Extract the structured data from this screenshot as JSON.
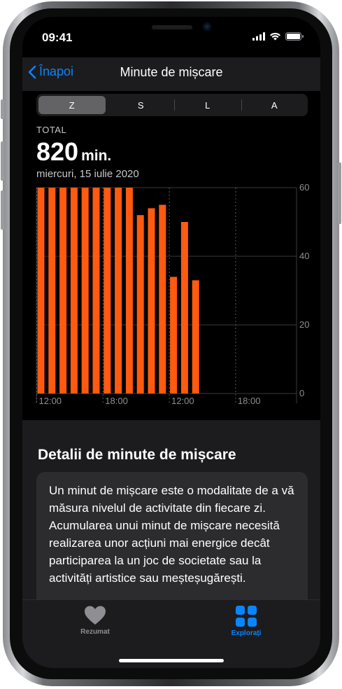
{
  "status": {
    "time": "09:41"
  },
  "nav": {
    "back_label": "Înapoi",
    "title": "Minute de mișcare"
  },
  "segments": [
    {
      "label": "Z",
      "selected": true
    },
    {
      "label": "S",
      "selected": false
    },
    {
      "label": "L",
      "selected": false
    },
    {
      "label": "A",
      "selected": false
    }
  ],
  "summary": {
    "label": "TOTAL",
    "value": "820",
    "unit": "min.",
    "date": "miercuri, 15 iulie 2020"
  },
  "chart_data": {
    "type": "bar",
    "bar_color": "#ff5a0f",
    "y_ticks": [
      "60",
      "40",
      "20",
      "0"
    ],
    "ylim": [
      0,
      60
    ],
    "x_ticks": [
      "12:00",
      "18:00",
      "12:00",
      "18:00"
    ],
    "values": [
      60,
      60,
      60,
      60,
      60,
      60,
      60,
      60,
      60,
      52,
      54,
      55,
      34,
      50,
      33
    ],
    "grid": true
  },
  "details": {
    "title": "Detalii de minute de mișcare",
    "body": "Un minut de mișcare este o modalitate de a vă măsura nivelul de activitate din fiecare zi. Acumularea unui minut de mișcare necesită realizarea unor acțiuni mai energice decât participarea la un joc de societate sau la activități artistice sau meșteșugărești."
  },
  "tabs": [
    {
      "label": "Rezumat",
      "icon": "heart-icon",
      "active": false,
      "color": "#8e8e93"
    },
    {
      "label": "Explorați",
      "icon": "grid-icon",
      "active": true,
      "color": "#0a84ff"
    }
  ]
}
